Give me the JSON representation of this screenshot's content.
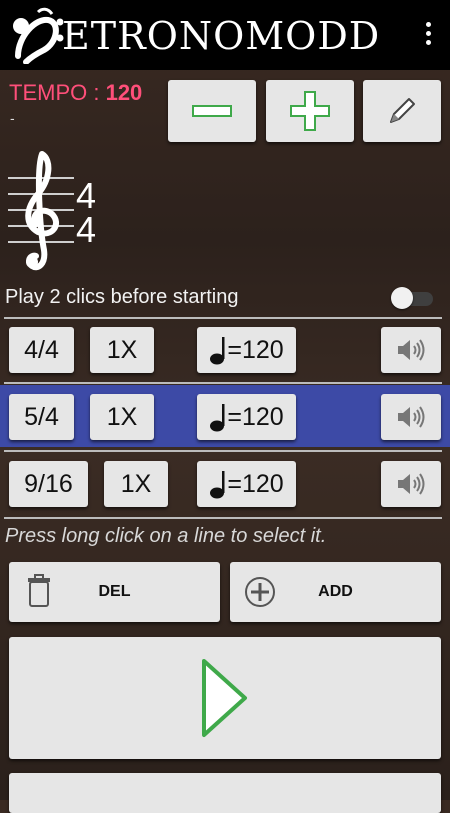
{
  "app": {
    "title": "ETRONOMODD"
  },
  "tempo": {
    "label": "TEMPO :",
    "value": "120",
    "sub": "-"
  },
  "time_signature": {
    "top": "4",
    "bottom": "4"
  },
  "preclick": {
    "label": "Play 2 clics before starting",
    "enabled": false
  },
  "rows": [
    {
      "signature": "4/4",
      "multiplier": "1X",
      "tempo": "=120",
      "selected": false
    },
    {
      "signature": "5/4",
      "multiplier": "1X",
      "tempo": "=120",
      "selected": true
    },
    {
      "signature": "9/16",
      "multiplier": "1X",
      "tempo": "=120",
      "selected": false
    }
  ],
  "hint": "Press long click on a line to select it.",
  "actions": {
    "del_label": "DEL",
    "add_label": "ADD"
  },
  "colors": {
    "tempo": "#ff4f7a",
    "selected_row": "#3d4aa6",
    "button": "#e6e6e6",
    "plus_minus": "#3fa94a"
  }
}
